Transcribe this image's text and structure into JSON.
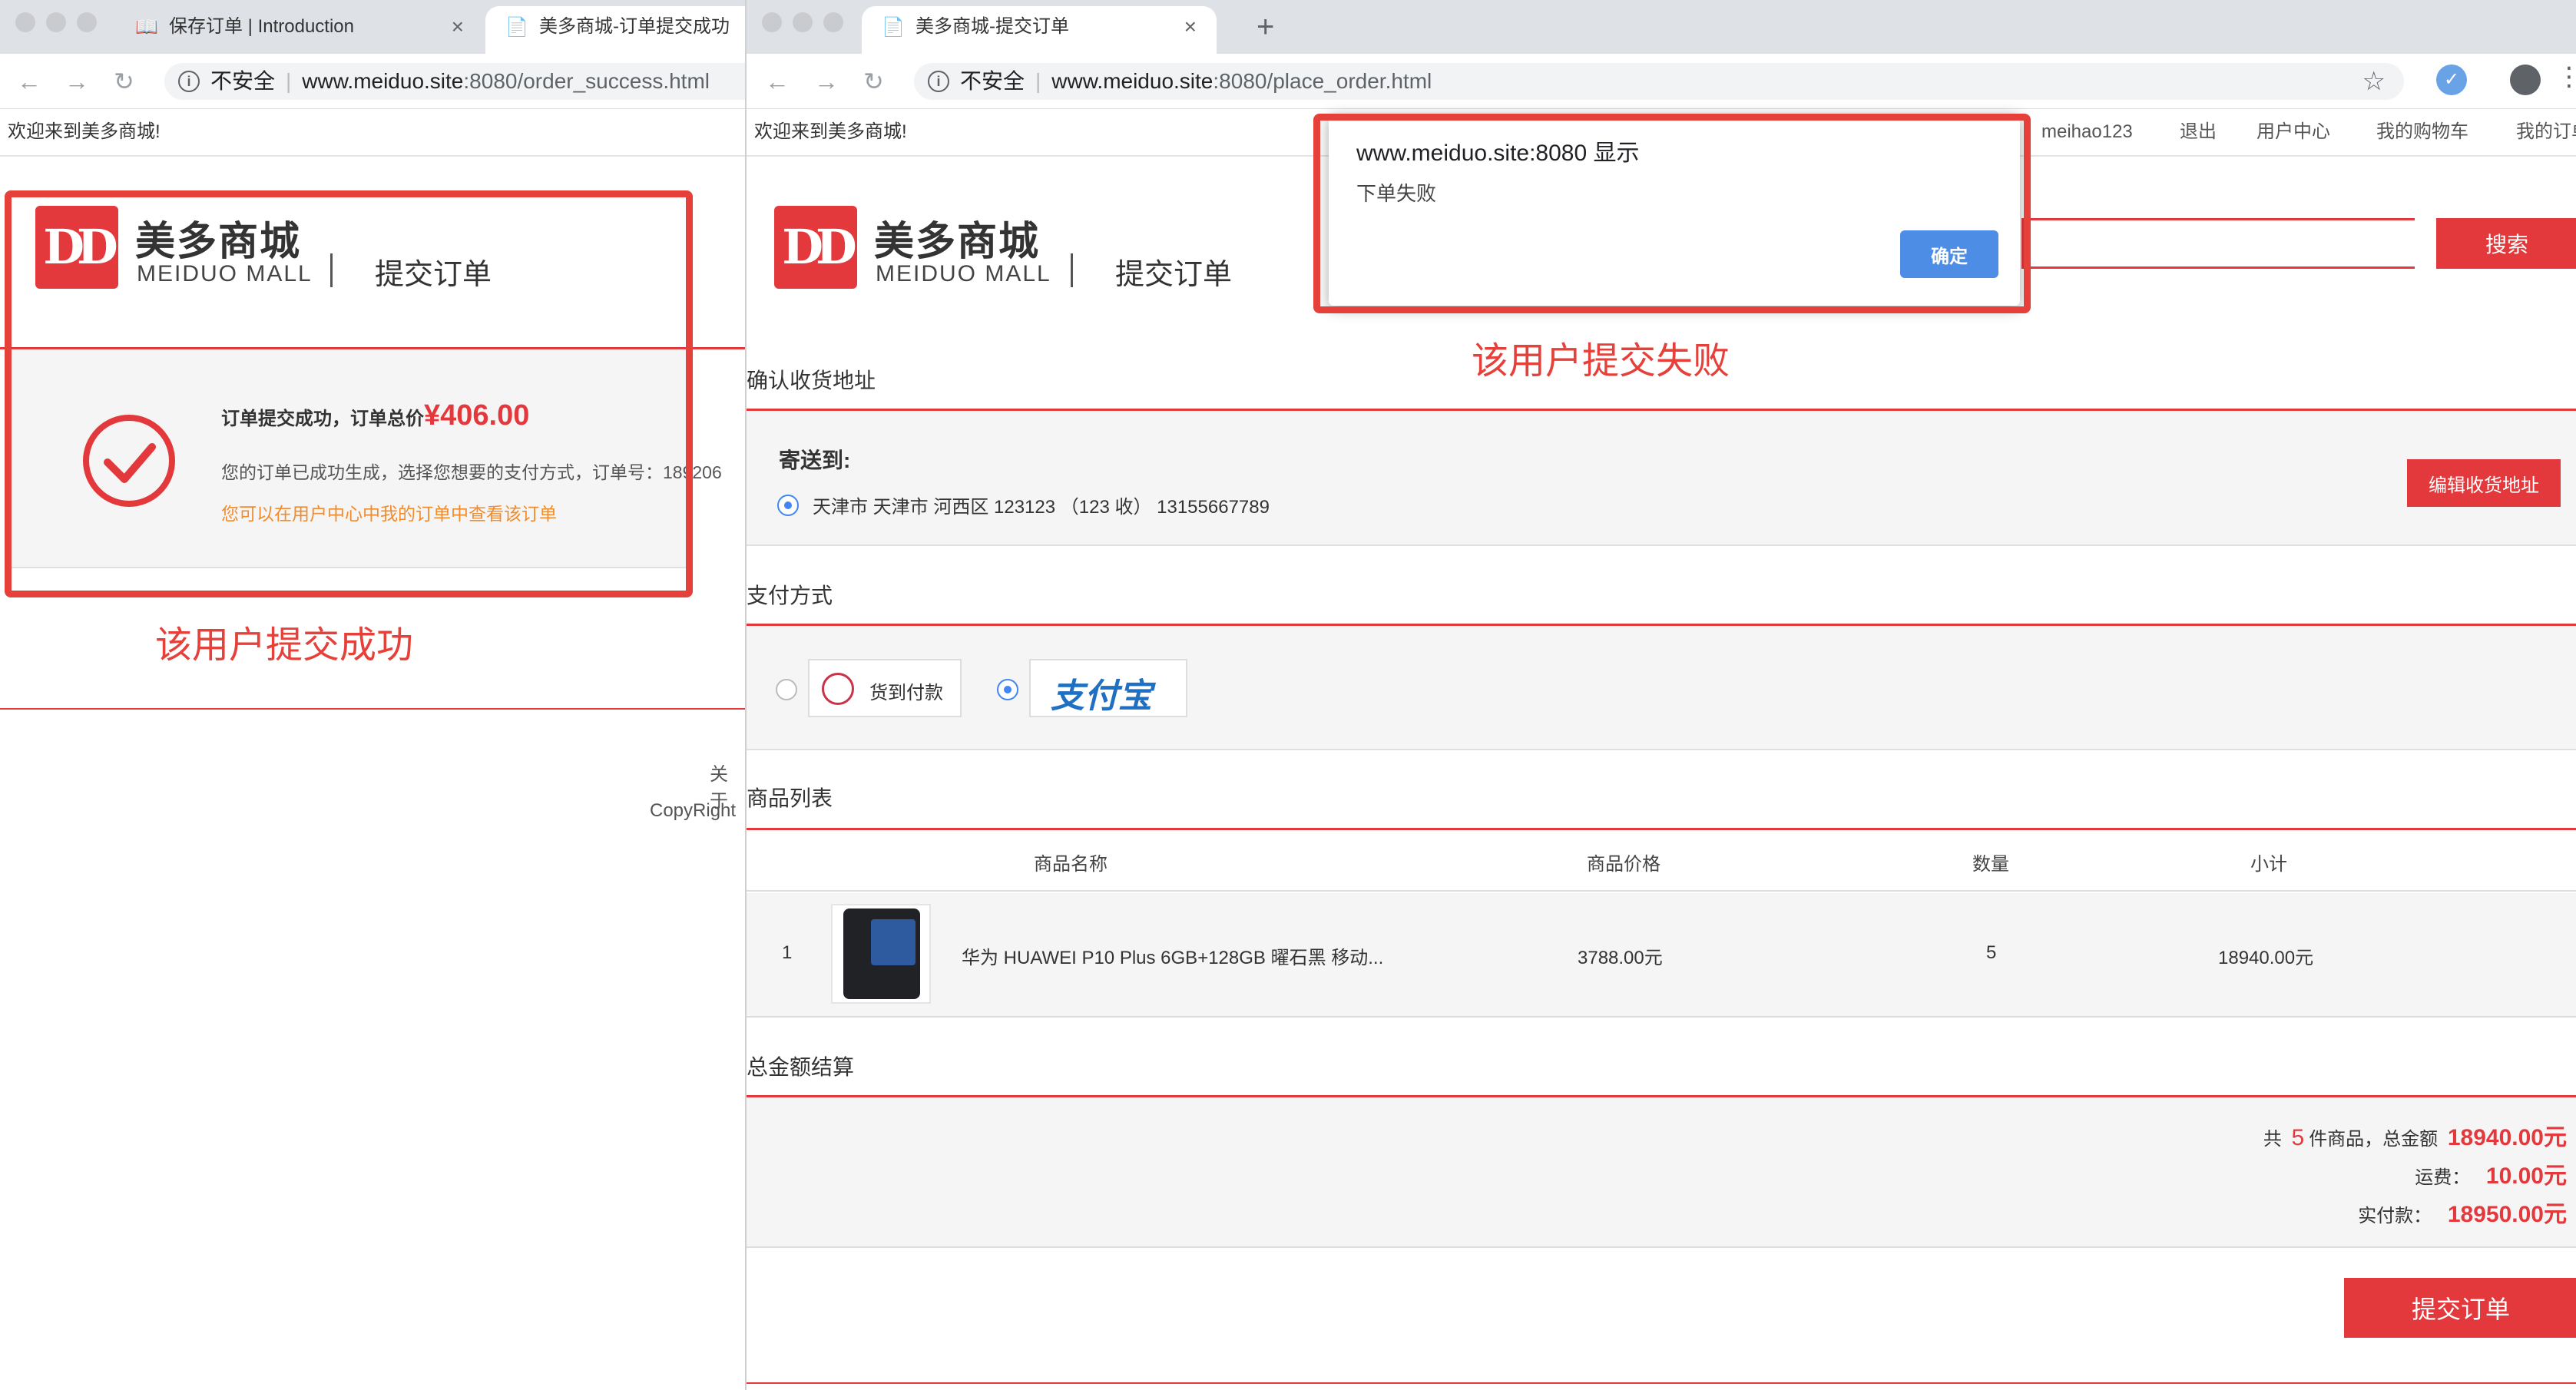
{
  "left_window": {
    "tabs": [
      {
        "label": "保存订单 | Introduction",
        "icon": "book-icon"
      },
      {
        "label": "美多商城-订单提交成功",
        "icon": "page-icon"
      }
    ],
    "security": "不安全",
    "url_host": "www.meiduo.site",
    "url_path": ":8080/order_success.html",
    "welcome": "欢迎来到美多商城!",
    "logo_cn": "美多商城",
    "logo_en": "MEIDUO MALL",
    "logo_sub": "提交订单",
    "success": {
      "headline": "订单提交成功，订单总价",
      "total": "¥406.00",
      "detail": "您的订单已成功生成，选择您想要的支付方式，订单号：189206",
      "link": "您可以在用户中心中我的订单中查看该订单"
    },
    "footer_about": "关于",
    "footer_copyright": "CopyRight"
  },
  "right_window": {
    "tab": {
      "label": "美多商城-提交订单",
      "icon": "page-icon"
    },
    "security": "不安全",
    "url_host": "www.meiduo.site",
    "url_path": ":8080/place_order.html",
    "welcome": "欢迎来到美多商城!",
    "top_nav": [
      "meihao123",
      "退出",
      "用户中心",
      "我的购物车",
      "我的订单"
    ],
    "logo_cn": "美多商城",
    "logo_en": "MEIDUO MALL",
    "logo_sub": "提交订单",
    "search_button": "搜索",
    "address_section": "确认收货地址",
    "ship_to": "寄送到:",
    "address": "天津市 天津市 河西区 123123 （123 收） 13155667789",
    "edit_address": "编辑收货地址",
    "payment_section": "支付方式",
    "pay_cod": "货到付款",
    "pay_alipay": "支付宝",
    "goods_section": "商品列表",
    "table_headers": [
      "商品名称",
      "商品价格",
      "数量",
      "小计"
    ],
    "rows": [
      {
        "index": "1",
        "name": "华为 HUAWEI P10 Plus 6GB+128GB 曜石黑 移动...",
        "price": "3788.00元",
        "qty": "5",
        "subtotal": "18940.00元"
      }
    ],
    "summary_section": "总金额结算",
    "summary": {
      "count_prefix": "共",
      "count": "5",
      "count_suffix": "件商品，总金额",
      "total": "18940.00元",
      "freight_label": "运费：",
      "freight": "10.00元",
      "pay_label": "实付款：",
      "pay": "18950.00元"
    },
    "submit_button": "提交订单"
  },
  "dialog": {
    "title": "www.meiduo.site:8080 显示",
    "message": "下单失败",
    "ok_button": "确定"
  },
  "annotations": {
    "success_label": "该用户提交成功",
    "fail_label": "该用户提交失败"
  },
  "colors": {
    "brand_red": "#e4393c",
    "annotation_red": "#e5413a",
    "dialog_button_blue": "#4d8de6",
    "link_orange": "#f08c2e"
  }
}
